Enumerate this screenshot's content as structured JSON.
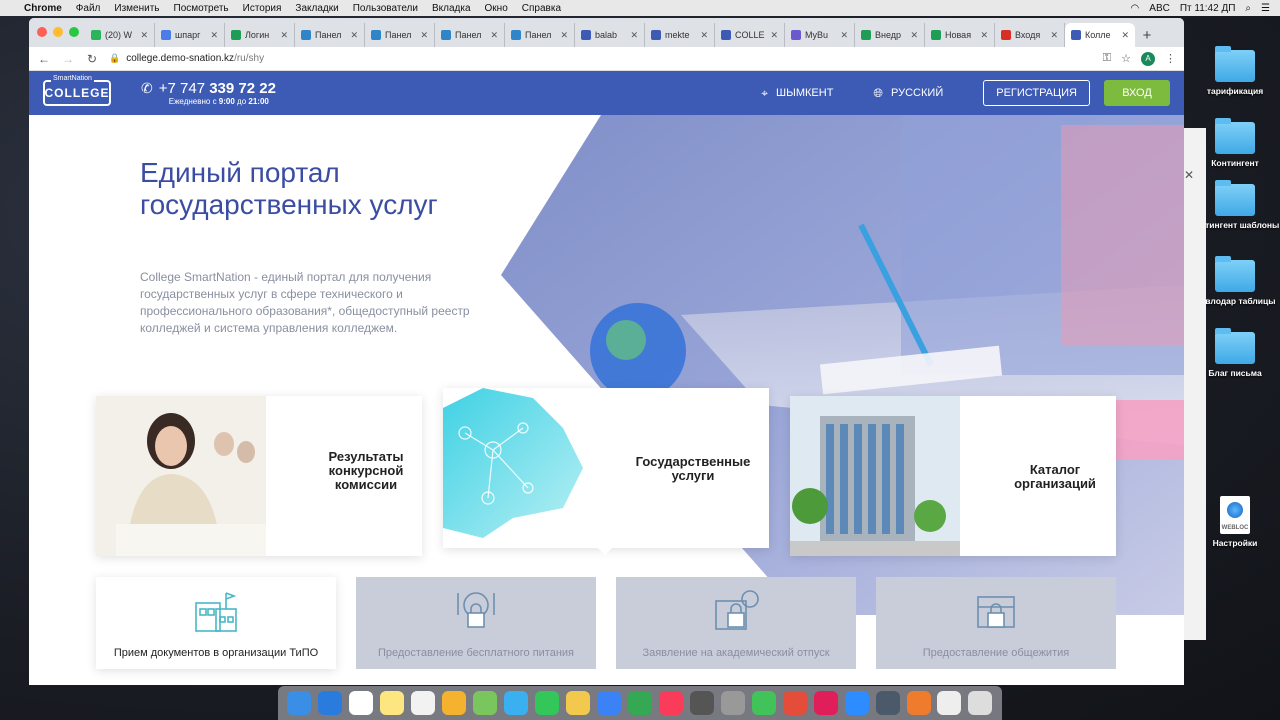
{
  "menubar": {
    "app": "Chrome",
    "items": [
      "Файл",
      "Изменить",
      "Посмотреть",
      "История",
      "Закладки",
      "Пользователи",
      "Вкладка",
      "Окно",
      "Справка"
    ],
    "input_method": "ABC",
    "clock": "Пт 11:42 ДП"
  },
  "browser": {
    "tabs": [
      {
        "title": "(20) W",
        "color": "#2ab55a"
      },
      {
        "title": "шпарг",
        "color": "#4a7de8"
      },
      {
        "title": "Логин",
        "color": "#1f9d55"
      },
      {
        "title": "Панел",
        "color": "#2e86c9"
      },
      {
        "title": "Панел",
        "color": "#2e86c9"
      },
      {
        "title": "Панел",
        "color": "#2e86c9"
      },
      {
        "title": "Панел",
        "color": "#2e86c9"
      },
      {
        "title": "balab",
        "color": "#3d5bb5"
      },
      {
        "title": "mekte",
        "color": "#3d5bb5"
      },
      {
        "title": "COLLE",
        "color": "#3d5bb5"
      },
      {
        "title": "MyBu",
        "color": "#6a5acd"
      },
      {
        "title": "Внедр",
        "color": "#1f9d55"
      },
      {
        "title": "Новая",
        "color": "#1f9d55"
      },
      {
        "title": "Входя",
        "color": "#d93025"
      },
      {
        "title": "Колле",
        "color": "#3d5bb5",
        "active": true
      }
    ],
    "url": "college.demo-snation.kz",
    "url_path": "/ru/shy",
    "profile_initial": "A"
  },
  "site": {
    "logo_top": "SmartNation",
    "logo_main": "COLLEGE",
    "phone_prefix": "+7 747 ",
    "phone_main": "339 72 22",
    "hours_prefix": "Ежедневно с ",
    "hours_from": "9:00",
    "hours_mid": " до ",
    "hours_to": "21:00",
    "city": "ШЫМКЕНТ",
    "language": "РУССКИЙ",
    "register": "РЕГИСТРАЦИЯ",
    "login": "ВХОД"
  },
  "hero": {
    "title": "Единый портал государственных услуг",
    "description": "College SmartNation - единый портал для получения государственных услуг в сфере технического и профессионального образования*, общедоступный реестр колледжей и система управления колледжем."
  },
  "cards": [
    {
      "label": "Результаты конкурсной комиссии"
    },
    {
      "label": "Государственные услуги"
    },
    {
      "label": "Каталог организаций"
    }
  ],
  "services": [
    {
      "label": "Прием документов в организации ТиПО",
      "enabled": true,
      "icon": "school-icon"
    },
    {
      "label": "Предоставление бесплатного питания",
      "enabled": false,
      "icon": "meal-lock-icon"
    },
    {
      "label": "Заявление на академический отпуск",
      "enabled": false,
      "icon": "leave-lock-icon"
    },
    {
      "label": "Предоставление общежития",
      "enabled": false,
      "icon": "dormitory-lock-icon"
    }
  ],
  "desktop": {
    "items": [
      "тарификация",
      "Контингент",
      "контингент шаблоны",
      "Павлодар таблицы",
      "Благ письма",
      "Настройки"
    ],
    "webloc_label": "WEBLOC"
  }
}
